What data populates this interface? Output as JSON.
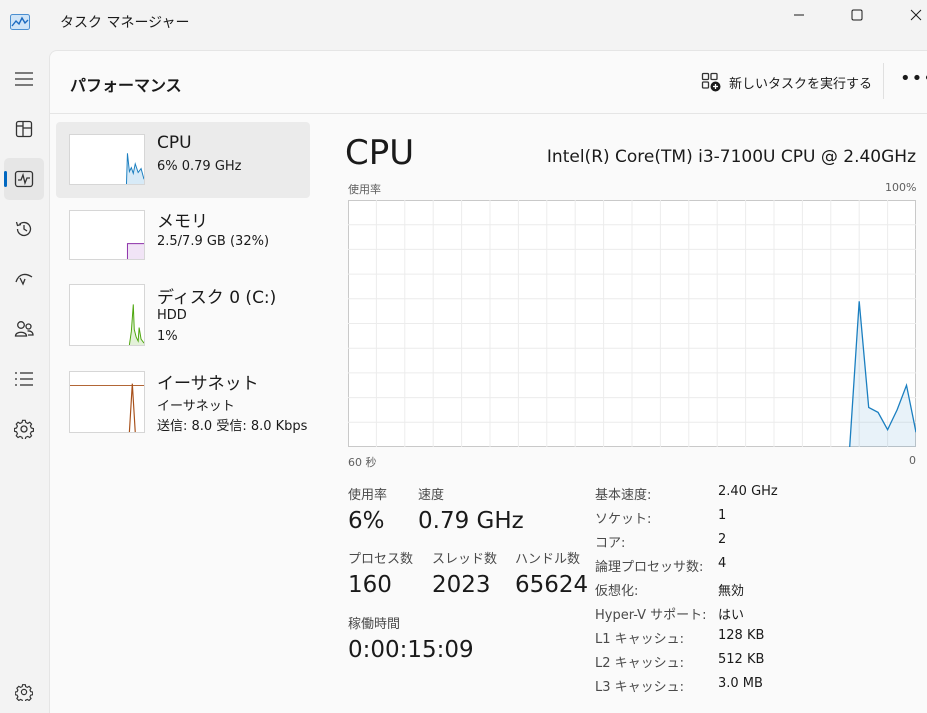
{
  "app": {
    "title": "タスク マネージャー",
    "icon": "task-manager-icon"
  },
  "window_controls": [
    "minimize",
    "maximize",
    "close"
  ],
  "nav_rail": [
    {
      "icon": "hamburger-menu-icon",
      "active": false
    },
    {
      "icon": "processes-icon",
      "active": false
    },
    {
      "icon": "performance-icon",
      "active": true
    },
    {
      "icon": "app-history-icon",
      "active": false
    },
    {
      "icon": "startup-apps-icon",
      "active": false
    },
    {
      "icon": "users-icon",
      "active": false
    },
    {
      "icon": "details-icon",
      "active": false
    },
    {
      "icon": "services-icon",
      "active": false
    },
    {
      "icon": "settings-icon",
      "active": false
    }
  ],
  "header": {
    "page_title": "パフォーマンス",
    "run_new_task": "新しいタスクを実行する",
    "more": "•••"
  },
  "devices": [
    {
      "name": "CPU",
      "line1": "6%  0.79 GHz",
      "line2": "",
      "active": true,
      "color": "#1b7fc0"
    },
    {
      "name": "メモリ",
      "line1": "2.5/7.9 GB (32%)",
      "line2": "",
      "active": false,
      "color": "#8b2fa8"
    },
    {
      "name": "ディスク 0 (C:)",
      "line1": "HDD",
      "line2": "1%",
      "active": false,
      "color": "#4ca60c"
    },
    {
      "name": "イーサネット",
      "line1": "イーサネット",
      "line2": "送信: 8.0  受信: 8.0 Kbps",
      "active": false,
      "color": "#a7501a"
    }
  ],
  "detail": {
    "title": "CPU",
    "model": "Intel(R) Core(TM) i3-7100U CPU @ 2.40GHz",
    "graph_top_left": "使用率",
    "graph_top_right": "100%",
    "graph_bottom_left": "60 秒",
    "graph_bottom_right": "0",
    "stats": {
      "usage_label": "使用率",
      "usage_value": "6%",
      "speed_label": "速度",
      "speed_value": "0.79 GHz",
      "processes_label": "プロセス数",
      "processes_value": "160",
      "threads_label": "スレッド数",
      "threads_value": "2023",
      "handles_label": "ハンドル数",
      "handles_value": "65624",
      "uptime_label": "稼働時間",
      "uptime_value": "0:00:15:09"
    },
    "info": [
      {
        "key": "基本速度:",
        "value": "2.40 GHz"
      },
      {
        "key": "ソケット:",
        "value": "1"
      },
      {
        "key": "コア:",
        "value": "2"
      },
      {
        "key": "論理プロセッサ数:",
        "value": "4"
      },
      {
        "key": "仮想化:",
        "value": "無効"
      },
      {
        "key": "Hyper-V サポート:",
        "value": "はい"
      },
      {
        "key": "L1 キャッシュ:",
        "value": "128 KB"
      },
      {
        "key": "L2 キャッシュ:",
        "value": "512 KB"
      },
      {
        "key": "L3 キャッシュ:",
        "value": "3.0 MB"
      }
    ]
  },
  "chart_data": {
    "type": "area",
    "x": [
      60,
      6,
      5,
      4,
      3,
      2,
      1,
      0
    ],
    "xlim": [
      60,
      0
    ],
    "ylim": [
      0,
      100
    ],
    "grid": true,
    "color": "#1b7fc0",
    "series": [
      {
        "values": [
          0,
          59,
          16,
          14,
          7,
          15,
          25,
          6
        ]
      }
    ]
  }
}
